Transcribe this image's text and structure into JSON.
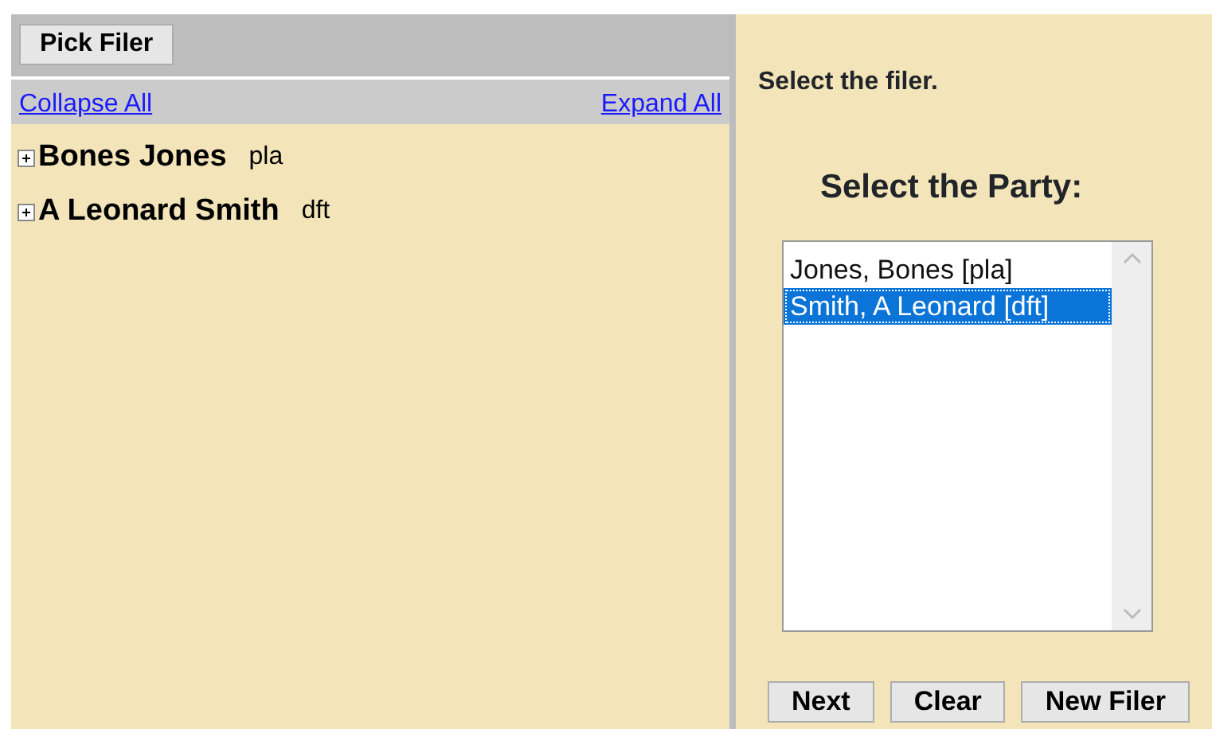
{
  "left_panel": {
    "pick_button": "Pick Filer",
    "collapse_link": "Collapse All",
    "expand_link": "Expand All",
    "tree": [
      {
        "name": "Bones Jones",
        "role": "pla",
        "expanded": false
      },
      {
        "name": "A Leonard Smith",
        "role": "dft",
        "expanded": false
      }
    ]
  },
  "right_panel": {
    "instruction": "Select the filer.",
    "heading": "Select the Party:",
    "parties": [
      {
        "label": "Jones, Bones [pla]",
        "selected": false
      },
      {
        "label": "Smith, A Leonard [dft]",
        "selected": true
      }
    ],
    "buttons": [
      "Next",
      "Clear",
      "New Filer"
    ]
  }
}
